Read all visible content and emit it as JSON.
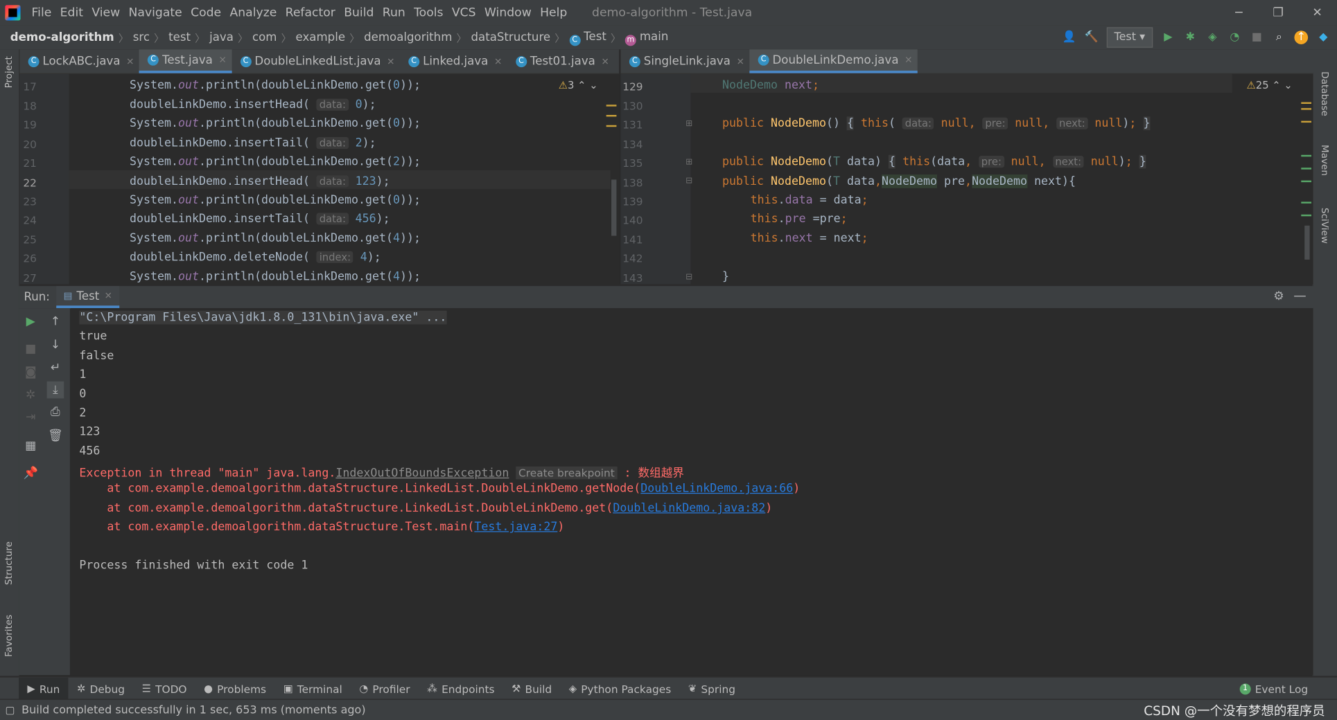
{
  "window": {
    "title": "demo-algorithm - Test.java",
    "menu": [
      "File",
      "Edit",
      "View",
      "Navigate",
      "Code",
      "Analyze",
      "Refactor",
      "Build",
      "Run",
      "Tools",
      "VCS",
      "Window",
      "Help"
    ],
    "controls": {
      "minimize": "─",
      "restore": "❐",
      "close": "✕"
    }
  },
  "breadcrumb": [
    "demo-algorithm",
    "src",
    "test",
    "java",
    "com",
    "example",
    "demoalgorithm",
    "dataStructure",
    "Test",
    "main"
  ],
  "toolbar": {
    "run_config": "Test"
  },
  "left_tabs": [
    "LockABC.java",
    "Test.java",
    "DoubleLinkedList.java",
    "Linked.java",
    "Test01.java"
  ],
  "right_tabs": [
    "SingleLink.java",
    "DoubleLinkDemo.java"
  ],
  "left_editor": {
    "warnings": "3",
    "line_numbers": [
      "17",
      "18",
      "19",
      "20",
      "21",
      "22",
      "23",
      "24",
      "25",
      "26",
      "27"
    ]
  },
  "right_editor": {
    "warnings": "25",
    "line_numbers": [
      "129",
      "130",
      "131",
      "134",
      "135",
      "138",
      "139",
      "140",
      "141",
      "142",
      "143"
    ]
  },
  "code_tokens": {
    "sys": "System.",
    "out": "out",
    "println": ".println(",
    "dl": "doubleLinkDemo",
    "get": ".get(",
    "insertHead": ".insertHead(",
    "insertTail": ".insertTail(",
    "deleteNode": ".deleteNode(",
    "close2": "));",
    "close1": ");",
    "hint_data": "data:",
    "hint_index": "index:",
    "n0": "0",
    "n2": "2",
    "n4": "4",
    "n123": "123",
    "n456": "456",
    "nodeDemo": "NodeDemo",
    "next": "next",
    "semi": ";",
    "public": "public",
    "this": "this",
    "null": "null",
    "hint_pre": "pre:",
    "hint_next": "next:",
    "T": "T",
    "data_kw": "data",
    "pre_kw": "pre"
  },
  "run_panel": {
    "label": "Run:",
    "tab": "Test",
    "console": {
      "cmd": "\"C:\\Program Files\\Java\\jdk1.8.0_131\\bin\\java.exe\" ...",
      "out": [
        "true",
        "false",
        "1",
        "0",
        "2",
        "123",
        "456"
      ],
      "exc_prefix": "Exception in thread \"main\" java.lang.",
      "exc_class": "IndexOutOfBoundsException",
      "create_bp": "Create breakpoint",
      "exc_msg": " : 数组越界",
      "trace": [
        {
          "at": "    at com.example.demoalgorithm.dataStructure.LinkedList.DoubleLinkDemo.getNode(",
          "link": "DoubleLinkDemo.java:66",
          "end": ")"
        },
        {
          "at": "    at com.example.demoalgorithm.dataStructure.LinkedList.DoubleLinkDemo.get(",
          "link": "DoubleLinkDemo.java:82",
          "end": ")"
        },
        {
          "at": "    at com.example.demoalgorithm.dataStructure.Test.main(",
          "link": "Test.java:27",
          "end": ")"
        }
      ],
      "finish": "Process finished with exit code 1"
    }
  },
  "side_labels": {
    "left": [
      "Project",
      "Structure",
      "Favorites"
    ],
    "right": [
      "Database",
      "Maven",
      "SciView"
    ]
  },
  "tool_windows": [
    "Run",
    "Debug",
    "TODO",
    "Problems",
    "Terminal",
    "Profiler",
    "Endpoints",
    "Build",
    "Python Packages",
    "Spring"
  ],
  "event_log": "Event Log",
  "event_count": "1",
  "status": "Build completed successfully in 1 sec, 653 ms (moments ago)",
  "watermark": "CSDN @一个没有梦想的程序员"
}
